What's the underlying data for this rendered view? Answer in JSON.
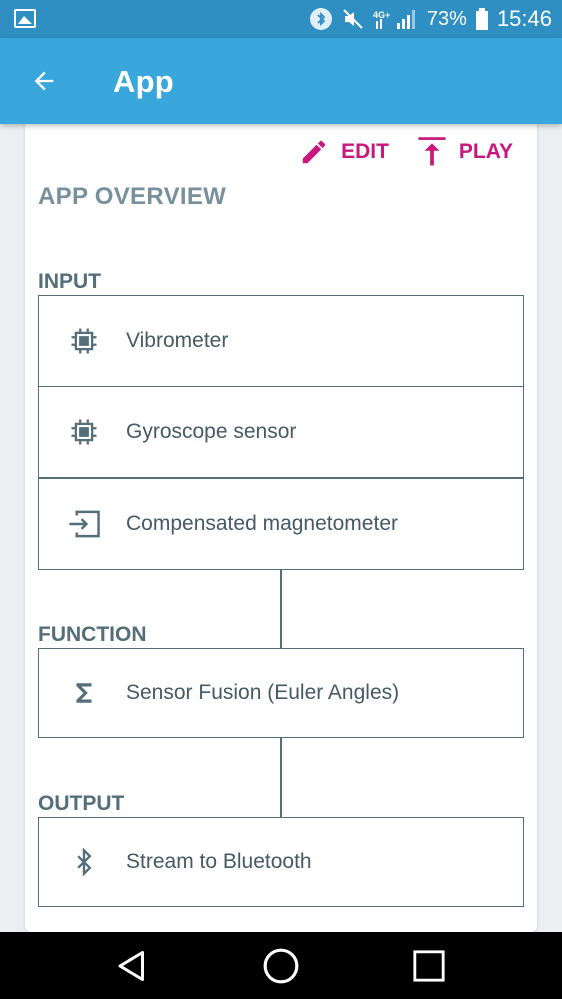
{
  "status_bar": {
    "battery_percent": "73%",
    "time": "15:46",
    "network_badge": "4G+"
  },
  "app_bar": {
    "title": "App"
  },
  "actions": {
    "edit_label": "EDIT",
    "play_label": "PLAY"
  },
  "overview": {
    "title": "APP OVERVIEW"
  },
  "sections": {
    "input_label": "INPUT",
    "function_label": "FUNCTION",
    "output_label": "OUTPUT"
  },
  "input_items": [
    {
      "label": "Vibrometer",
      "icon": "chip-icon"
    },
    {
      "label": "Gyroscope sensor",
      "icon": "chip-icon"
    },
    {
      "label": "Compensated magnetometer",
      "icon": "input-arrow-icon"
    }
  ],
  "function_items": [
    {
      "label": "Sensor Fusion (Euler Angles)",
      "icon": "sigma-icon"
    }
  ],
  "output_items": [
    {
      "label": "Stream to Bluetooth",
      "icon": "bluetooth-icon"
    }
  ],
  "colors": {
    "status_bar": "#2f8fc2",
    "app_bar": "#3aa7dc",
    "accent": "#c8187e",
    "border": "#546e7a",
    "background": "#eceff1"
  }
}
